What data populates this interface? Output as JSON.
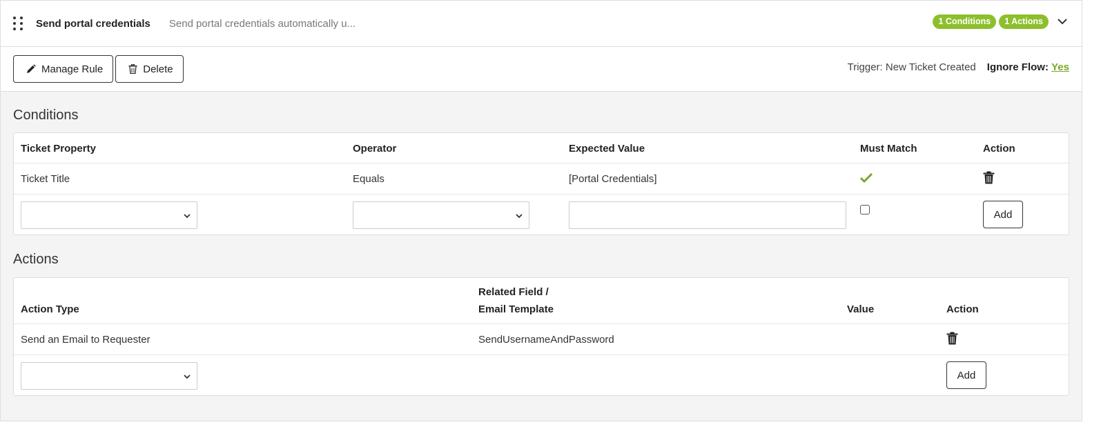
{
  "header": {
    "title": "Send portal credentials",
    "description": "Send portal credentials automatically u...",
    "badges": [
      "1 Conditions",
      "1 Actions"
    ]
  },
  "toolbar": {
    "manage_label": "Manage Rule",
    "delete_label": "Delete",
    "trigger_label": "Trigger:",
    "trigger_value": "New Ticket Created",
    "ignore_flow_label": "Ignore Flow:",
    "ignore_flow_value": "Yes"
  },
  "conditions": {
    "title": "Conditions",
    "headers": [
      "Ticket Property",
      "Operator",
      "Expected Value",
      "Must Match",
      "Action"
    ],
    "rows": [
      {
        "property": "Ticket Title",
        "operator": "Equals",
        "expected": "[Portal Credentials]",
        "must_match": true
      }
    ],
    "new_row": {
      "property": "",
      "operator": "",
      "expected": "",
      "must_match": false,
      "add_label": "Add"
    }
  },
  "actions": {
    "title": "Actions",
    "headers": [
      "Action Type",
      "Related Field /",
      "Email Template",
      "Value",
      "Action"
    ],
    "rows": [
      {
        "type": "Send an Email to Requester",
        "related": "SendUsernameAndPassword",
        "value": ""
      }
    ],
    "new_row": {
      "type": "",
      "add_label": "Add"
    }
  },
  "colors": {
    "accent": "#8dbf2c",
    "link": "#7aa82a",
    "check": "#7aa82a"
  },
  "icons": [
    "drag-handle-icon",
    "chevron-down-icon",
    "pencil-icon",
    "trash-icon",
    "checkmark-icon",
    "caret-down-icon"
  ]
}
